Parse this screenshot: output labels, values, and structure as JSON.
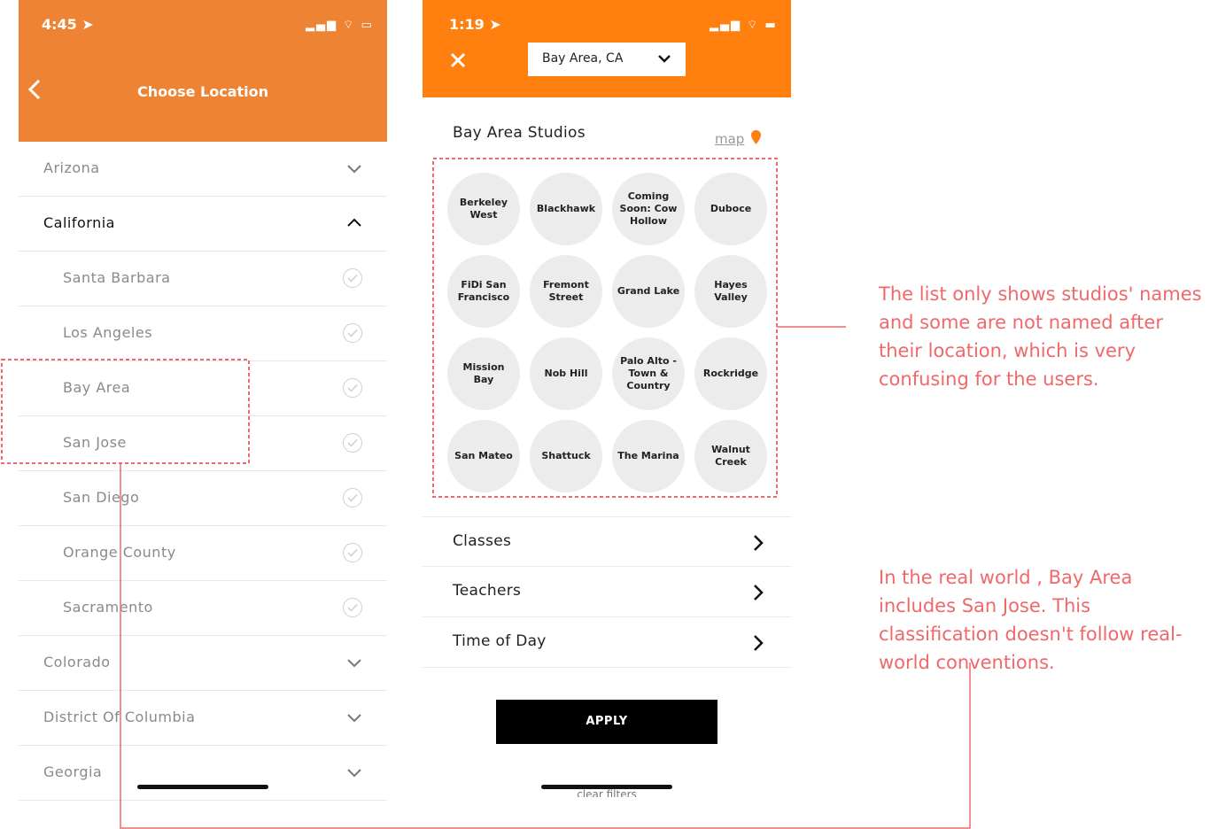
{
  "left_screen": {
    "status": {
      "time": "4:45 ➤",
      "icons": "▂▄▆ ⌔ ▭"
    },
    "header": {
      "back_icon": "chevron-left-icon",
      "title": "Choose Location"
    },
    "rows": [
      {
        "label": "Arizona",
        "kind": "state",
        "state": "collapsed"
      },
      {
        "label": "California",
        "kind": "state",
        "state": "expanded"
      },
      {
        "label": "Santa Barbara",
        "kind": "city"
      },
      {
        "label": "Los Angeles",
        "kind": "city"
      },
      {
        "label": "Bay Area",
        "kind": "city"
      },
      {
        "label": "San Jose",
        "kind": "city"
      },
      {
        "label": "San Diego",
        "kind": "city"
      },
      {
        "label": "Orange County",
        "kind": "city"
      },
      {
        "label": "Sacramento",
        "kind": "city"
      },
      {
        "label": "Colorado",
        "kind": "state",
        "state": "collapsed"
      },
      {
        "label": "District Of Columbia",
        "kind": "state",
        "state": "collapsed"
      },
      {
        "label": "Georgia",
        "kind": "state",
        "state": "collapsed"
      }
    ]
  },
  "right_screen": {
    "status": {
      "time": "1:19 ➤",
      "icons": "▂▄▆ ⌔ ▬"
    },
    "header": {
      "close_icon": "close-icon",
      "location_select": "Bay Area, CA"
    },
    "studios_title": "Bay Area Studios",
    "map_link": "map",
    "studios": [
      "Berkeley West",
      "Blackhawk",
      "Coming Soon: Cow Hollow",
      "Duboce",
      "FiDi San Francisco",
      "Fremont Street",
      "Grand Lake",
      "Hayes Valley",
      "Mission Bay",
      "Nob Hill",
      "Palo Alto - Town & Country",
      "Rockridge",
      "San Mateo",
      "Shattuck",
      "The Marina",
      "Walnut Creek"
    ],
    "filters": [
      "Classes",
      "Teachers",
      "Time of Day"
    ],
    "apply_label": "APPLY",
    "clear_label": "clear filters"
  },
  "annotations": {
    "note1": "The list only shows studios' names and some are not named after their location, which is very confusing for the users.",
    "note2": "In the real world , Bay Area includes San Jose. This classification doesn't follow real-world conventions.",
    "color": "#f0686a"
  },
  "colors": {
    "left_header": "#ee8433",
    "right_header": "#ff7f0f"
  }
}
